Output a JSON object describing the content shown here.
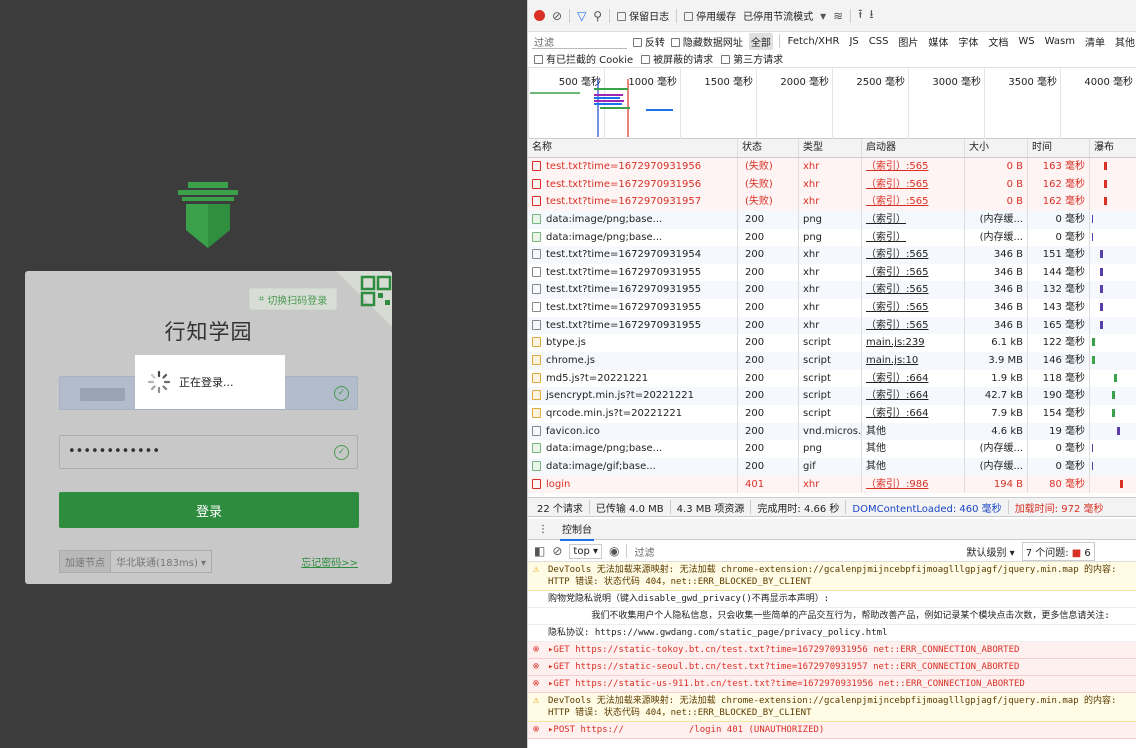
{
  "login": {
    "qr_switch_label": "切换扫码登录",
    "site_title": "行知学园",
    "password_mask": "••••••••••••",
    "login_button": "登录",
    "node_label": "加速节点",
    "node_select": "华北联通(183ms) ▾",
    "forgot_link": "忘记密码>>",
    "loading_text": "正在登录..."
  },
  "devtools": {
    "toolbar": {
      "preserve_log": "保留日志",
      "disable_cache": "停用缓存",
      "throttle": "已停用节流模式",
      "filter_placeholder": "过滤",
      "invert": "反转",
      "hide_data_urls": "隐藏数据网址",
      "types": [
        "全部",
        "Fetch/XHR",
        "JS",
        "CSS",
        "图片",
        "媒体",
        "字体",
        "文档",
        "WS",
        "Wasm",
        "清单",
        "其他"
      ],
      "blocked_cookies": "有已拦截的 Cookie",
      "blocked_requests": "被屏蔽的请求",
      "third_party": "第三方请求"
    },
    "timeline_ticks": [
      "500 毫秒",
      "1000 毫秒",
      "1500 毫秒",
      "2000 毫秒",
      "2500 毫秒",
      "3000 毫秒",
      "3500 毫秒",
      "4000 毫秒"
    ],
    "columns": [
      "名称",
      "状态",
      "类型",
      "启动器",
      "大小",
      "时间",
      "瀑布"
    ],
    "requests": [
      {
        "name": "test.txt?time=1672970931956",
        "status": "(失败)",
        "type": "xhr",
        "initiator": "（索引）:565",
        "size": "0 B",
        "time": "163 毫秒",
        "failed": true,
        "icon": "file"
      },
      {
        "name": "test.txt?time=1672970931956",
        "status": "(失败)",
        "type": "xhr",
        "initiator": "（索引）:565",
        "size": "0 B",
        "time": "162 毫秒",
        "failed": true,
        "icon": "file"
      },
      {
        "name": "test.txt?time=1672970931957",
        "status": "(失败)",
        "type": "xhr",
        "initiator": "（索引）:565",
        "size": "0 B",
        "time": "162 毫秒",
        "failed": true,
        "icon": "file"
      },
      {
        "name": "data:image/png;base...",
        "status": "200",
        "type": "png",
        "initiator": "（索引）",
        "size": "(内存缓...",
        "time": "0 毫秒",
        "failed": false,
        "icon": "img"
      },
      {
        "name": "data:image/png;base...",
        "status": "200",
        "type": "png",
        "initiator": "（索引）",
        "size": "(内存缓...",
        "time": "0 毫秒",
        "failed": false,
        "icon": "img"
      },
      {
        "name": "test.txt?time=1672970931954",
        "status": "200",
        "type": "xhr",
        "initiator": "（索引）:565",
        "size": "346 B",
        "time": "151 毫秒",
        "failed": false,
        "icon": "file"
      },
      {
        "name": "test.txt?time=1672970931955",
        "status": "200",
        "type": "xhr",
        "initiator": "（索引）:565",
        "size": "346 B",
        "time": "144 毫秒",
        "failed": false,
        "icon": "file"
      },
      {
        "name": "test.txt?time=1672970931955",
        "status": "200",
        "type": "xhr",
        "initiator": "（索引）:565",
        "size": "346 B",
        "time": "132 毫秒",
        "failed": false,
        "icon": "file"
      },
      {
        "name": "test.txt?time=1672970931955",
        "status": "200",
        "type": "xhr",
        "initiator": "（索引）:565",
        "size": "346 B",
        "time": "143 毫秒",
        "failed": false,
        "icon": "file"
      },
      {
        "name": "test.txt?time=1672970931955",
        "status": "200",
        "type": "xhr",
        "initiator": "（索引）:565",
        "size": "346 B",
        "time": "165 毫秒",
        "failed": false,
        "icon": "file"
      },
      {
        "name": "btype.js",
        "status": "200",
        "type": "script",
        "initiator": "main.js:239",
        "size": "6.1 kB",
        "time": "122 毫秒",
        "failed": false,
        "icon": "js"
      },
      {
        "name": "chrome.js",
        "status": "200",
        "type": "script",
        "initiator": "main.js:10",
        "size": "3.9 MB",
        "time": "146 毫秒",
        "failed": false,
        "icon": "js"
      },
      {
        "name": "md5.js?t=20221221",
        "status": "200",
        "type": "script",
        "initiator": "（索引）:664",
        "size": "1.9 kB",
        "time": "118 毫秒",
        "failed": false,
        "icon": "js"
      },
      {
        "name": "jsencrypt.min.js?t=20221221",
        "status": "200",
        "type": "script",
        "initiator": "（索引）:664",
        "size": "42.7 kB",
        "time": "190 毫秒",
        "failed": false,
        "icon": "js"
      },
      {
        "name": "qrcode.min.js?t=20221221",
        "status": "200",
        "type": "script",
        "initiator": "（索引）:664",
        "size": "7.9 kB",
        "time": "154 毫秒",
        "failed": false,
        "icon": "js"
      },
      {
        "name": "favicon.ico",
        "status": "200",
        "type": "vnd.micros...",
        "initiator": "其他",
        "size": "4.6 kB",
        "time": "19 毫秒",
        "failed": false,
        "icon": "file"
      },
      {
        "name": "data:image/png;base...",
        "status": "200",
        "type": "png",
        "initiator": "其他",
        "size": "(内存缓...",
        "time": "0 毫秒",
        "failed": false,
        "icon": "img"
      },
      {
        "name": "data:image/gif;base...",
        "status": "200",
        "type": "gif",
        "initiator": "其他",
        "size": "(内存缓...",
        "time": "0 毫秒",
        "failed": false,
        "icon": "img"
      },
      {
        "name": "login",
        "status": "401",
        "type": "xhr",
        "initiator": "（索引）:986",
        "size": "194 B",
        "time": "80 毫秒",
        "failed": true,
        "icon": "file"
      }
    ],
    "status_bar": {
      "requests": "22 个请求",
      "transferred": "已传输 4.0 MB",
      "resources": "4.3 MB 项资源",
      "finish": "完成用时: 4.66 秒",
      "dcl": "DOMContentLoaded: 460 毫秒",
      "load": "加载时间: 972 毫秒"
    },
    "console": {
      "tab": "控制台",
      "context": "top ▾",
      "filter_placeholder": "过滤",
      "levels": "默认级别 ▾",
      "issues": "7 个问题: ",
      "issue_count": "6",
      "lines": [
        {
          "kind": "warn",
          "text": "DevTools 无法加载来源映射: 无法加载 chrome-extension://gcalenpjmijncebpfijmoaglllgpjagf/jquery.min.map 的内容: HTTP 错误: 状态代码 404，net::ERR_BLOCKED_BY_CLIENT"
        },
        {
          "kind": "info",
          "text": "购物党隐私说明（键入disable_gwd_privacy()不再显示本声明）:"
        },
        {
          "kind": "info",
          "text": "        我们不收集用户个人隐私信息，只会收集一些简单的产品交互行为，帮助改善产品，例如记录某个模块点击次数，更多信息请关注:"
        },
        {
          "kind": "info",
          "text": "隐私协议: https://www.gwdang.com/static_page/privacy_policy.html"
        },
        {
          "kind": "err",
          "text": "▸GET https://static-tokoy.bt.cn/test.txt?time=1672970931956 net::ERR_CONNECTION_ABORTED"
        },
        {
          "kind": "err",
          "text": "▸GET https://static-seoul.bt.cn/test.txt?time=1672970931957 net::ERR_CONNECTION_ABORTED"
        },
        {
          "kind": "err",
          "text": "▸GET https://static-us-911.bt.cn/test.txt?time=1672970931956 net::ERR_CONNECTION_ABORTED"
        },
        {
          "kind": "warn",
          "text": "DevTools 无法加载来源映射: 无法加载 chrome-extension://gcalenpjmijncebpfijmoaglllgpjagf/jquery.min.map 的内容: HTTP 错误: 状态代码 404，net::ERR_BLOCKED_BY_CLIENT"
        },
        {
          "kind": "err",
          "text": "▸POST https://            /login 401 (UNAUTHORIZED)"
        }
      ]
    }
  }
}
